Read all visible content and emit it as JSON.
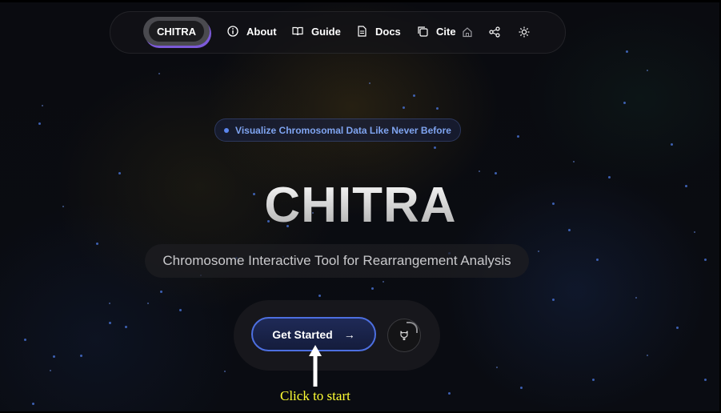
{
  "nav": {
    "brand": "CHITRA",
    "items": [
      {
        "label": "About",
        "icon": "info-icon"
      },
      {
        "label": "Guide",
        "icon": "book-icon"
      },
      {
        "label": "Docs",
        "icon": "document-icon"
      },
      {
        "label": "Cite",
        "icon": "copy-icon"
      }
    ],
    "icons": [
      "home-icon",
      "share-icon",
      "sun-icon"
    ]
  },
  "hero": {
    "badge": "Visualize Chromosomal Data Like Never Before",
    "title": "CHITRA",
    "subtitle": "Chromosome Interactive Tool for Rearrangement Analysis",
    "cta_label": "Get Started",
    "cta_arrow": "→"
  },
  "annotation": {
    "text": "Click to start",
    "color": "#ffff33"
  },
  "colors": {
    "accent": "#4d6fe0",
    "badge_text": "#7fa4f0",
    "brand_shadow": "#7c5ad8"
  }
}
